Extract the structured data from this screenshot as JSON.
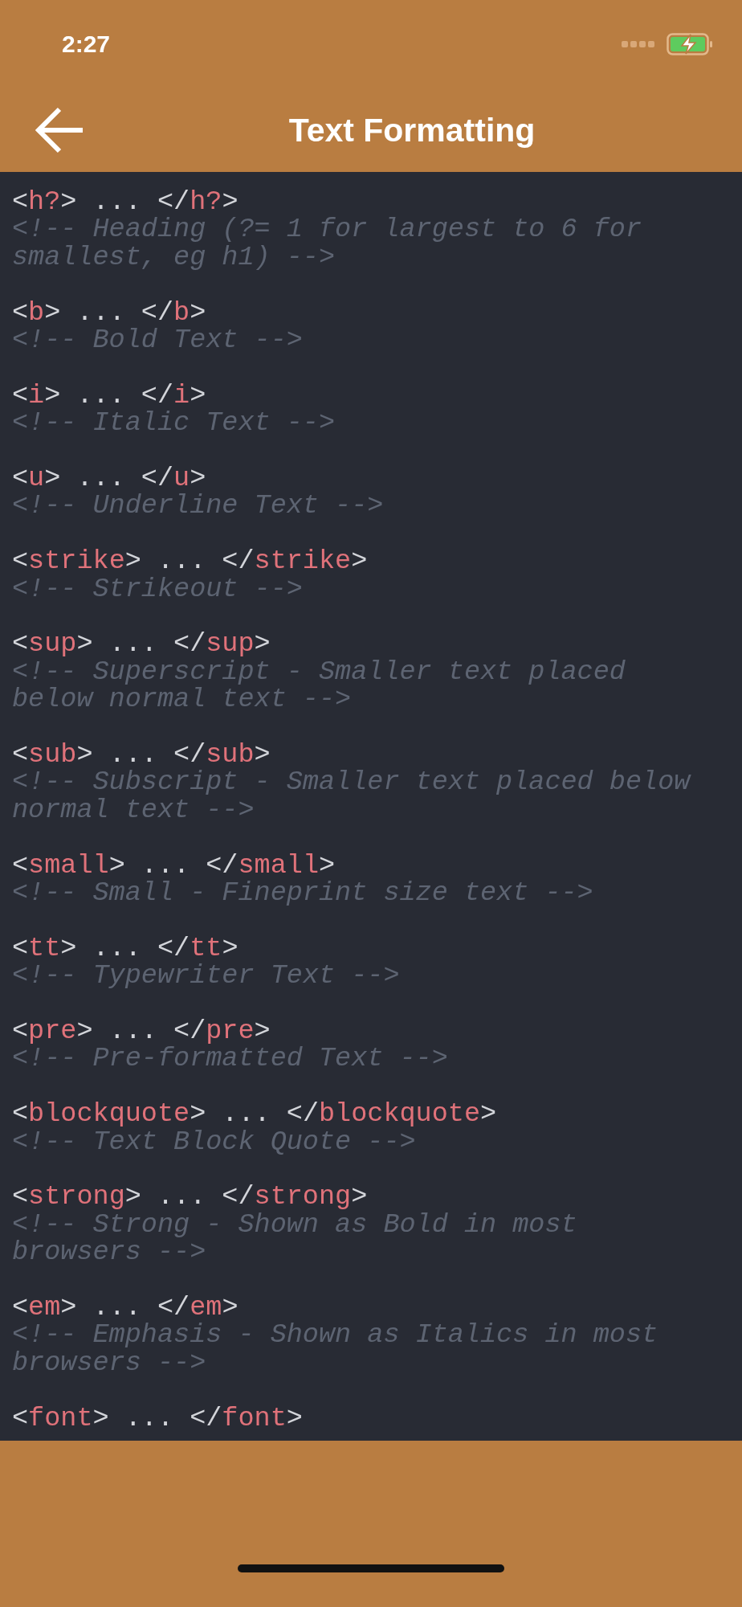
{
  "status_bar": {
    "time": "2:27"
  },
  "nav_bar": {
    "title": "Text Formatting"
  },
  "entries": [
    {
      "code": [
        {
          "kind": "punct",
          "text": "<"
        },
        {
          "kind": "tag",
          "text": "h?"
        },
        {
          "kind": "punct",
          "text": "> ... </"
        },
        {
          "kind": "tag",
          "text": "h?"
        },
        {
          "kind": "punct",
          "text": ">"
        }
      ],
      "comment": "<!-- Heading (?= 1 for largest to 6 for smallest, eg h1) -->"
    },
    {
      "code": [
        {
          "kind": "punct",
          "text": "<"
        },
        {
          "kind": "tag",
          "text": "b"
        },
        {
          "kind": "punct",
          "text": "> ... </"
        },
        {
          "kind": "tag",
          "text": "b"
        },
        {
          "kind": "punct",
          "text": ">"
        }
      ],
      "comment": "<!-- Bold Text -->"
    },
    {
      "code": [
        {
          "kind": "punct",
          "text": "<"
        },
        {
          "kind": "tag",
          "text": "i"
        },
        {
          "kind": "punct",
          "text": "> ... </"
        },
        {
          "kind": "tag",
          "text": "i"
        },
        {
          "kind": "punct",
          "text": ">"
        }
      ],
      "comment": "<!-- Italic Text -->"
    },
    {
      "code": [
        {
          "kind": "punct",
          "text": "<"
        },
        {
          "kind": "tag",
          "text": "u"
        },
        {
          "kind": "punct",
          "text": "> ... </"
        },
        {
          "kind": "tag",
          "text": "u"
        },
        {
          "kind": "punct",
          "text": ">"
        }
      ],
      "comment": "<!-- Underline Text -->"
    },
    {
      "code": [
        {
          "kind": "punct",
          "text": "<"
        },
        {
          "kind": "tag",
          "text": "strike"
        },
        {
          "kind": "punct",
          "text": "> ... </"
        },
        {
          "kind": "tag",
          "text": "strike"
        },
        {
          "kind": "punct",
          "text": ">"
        }
      ],
      "comment": "<!-- Strikeout -->"
    },
    {
      "code": [
        {
          "kind": "punct",
          "text": "<"
        },
        {
          "kind": "tag",
          "text": "sup"
        },
        {
          "kind": "punct",
          "text": "> ... </"
        },
        {
          "kind": "tag",
          "text": "sup"
        },
        {
          "kind": "punct",
          "text": ">"
        }
      ],
      "comment": "<!-- Superscript - Smaller text placed below normal text -->"
    },
    {
      "code": [
        {
          "kind": "punct",
          "text": "<"
        },
        {
          "kind": "tag",
          "text": "sub"
        },
        {
          "kind": "punct",
          "text": "> ... </"
        },
        {
          "kind": "tag",
          "text": "sub"
        },
        {
          "kind": "punct",
          "text": ">"
        }
      ],
      "comment": "<!-- Subscript - Smaller text placed below normal text -->"
    },
    {
      "code": [
        {
          "kind": "punct",
          "text": "<"
        },
        {
          "kind": "tag",
          "text": "small"
        },
        {
          "kind": "punct",
          "text": "> ... </"
        },
        {
          "kind": "tag",
          "text": "small"
        },
        {
          "kind": "punct",
          "text": ">"
        }
      ],
      "comment": "<!-- Small - Fineprint size text -->"
    },
    {
      "code": [
        {
          "kind": "punct",
          "text": "<"
        },
        {
          "kind": "tag",
          "text": "tt"
        },
        {
          "kind": "punct",
          "text": "> ... </"
        },
        {
          "kind": "tag",
          "text": "tt"
        },
        {
          "kind": "punct",
          "text": ">"
        }
      ],
      "comment": "<!-- Typewriter Text -->"
    },
    {
      "code": [
        {
          "kind": "punct",
          "text": "<"
        },
        {
          "kind": "tag",
          "text": "pre"
        },
        {
          "kind": "punct",
          "text": "> ... </"
        },
        {
          "kind": "tag",
          "text": "pre"
        },
        {
          "kind": "punct",
          "text": ">"
        }
      ],
      "comment": "<!-- Pre-formatted Text -->"
    },
    {
      "code": [
        {
          "kind": "punct",
          "text": "<"
        },
        {
          "kind": "tag",
          "text": "blockquote"
        },
        {
          "kind": "punct",
          "text": "> ... </"
        },
        {
          "kind": "tag",
          "text": "blockquote"
        },
        {
          "kind": "punct",
          "text": ">"
        }
      ],
      "comment": "<!-- Text Block Quote -->"
    },
    {
      "code": [
        {
          "kind": "punct",
          "text": "<"
        },
        {
          "kind": "tag",
          "text": "strong"
        },
        {
          "kind": "punct",
          "text": "> ... </"
        },
        {
          "kind": "tag",
          "text": "strong"
        },
        {
          "kind": "punct",
          "text": ">"
        }
      ],
      "comment": "<!-- Strong - Shown as Bold in most browsers -->"
    },
    {
      "code": [
        {
          "kind": "punct",
          "text": "<"
        },
        {
          "kind": "tag",
          "text": "em"
        },
        {
          "kind": "punct",
          "text": "> ... </"
        },
        {
          "kind": "tag",
          "text": "em"
        },
        {
          "kind": "punct",
          "text": ">"
        }
      ],
      "comment": "<!-- Emphasis - Shown as Italics in most browsers -->"
    },
    {
      "code": [
        {
          "kind": "punct",
          "text": "<"
        },
        {
          "kind": "tag",
          "text": "font"
        },
        {
          "kind": "punct",
          "text": "> ... </"
        },
        {
          "kind": "tag",
          "text": "font"
        },
        {
          "kind": "punct",
          "text": ">"
        }
      ]
    }
  ]
}
